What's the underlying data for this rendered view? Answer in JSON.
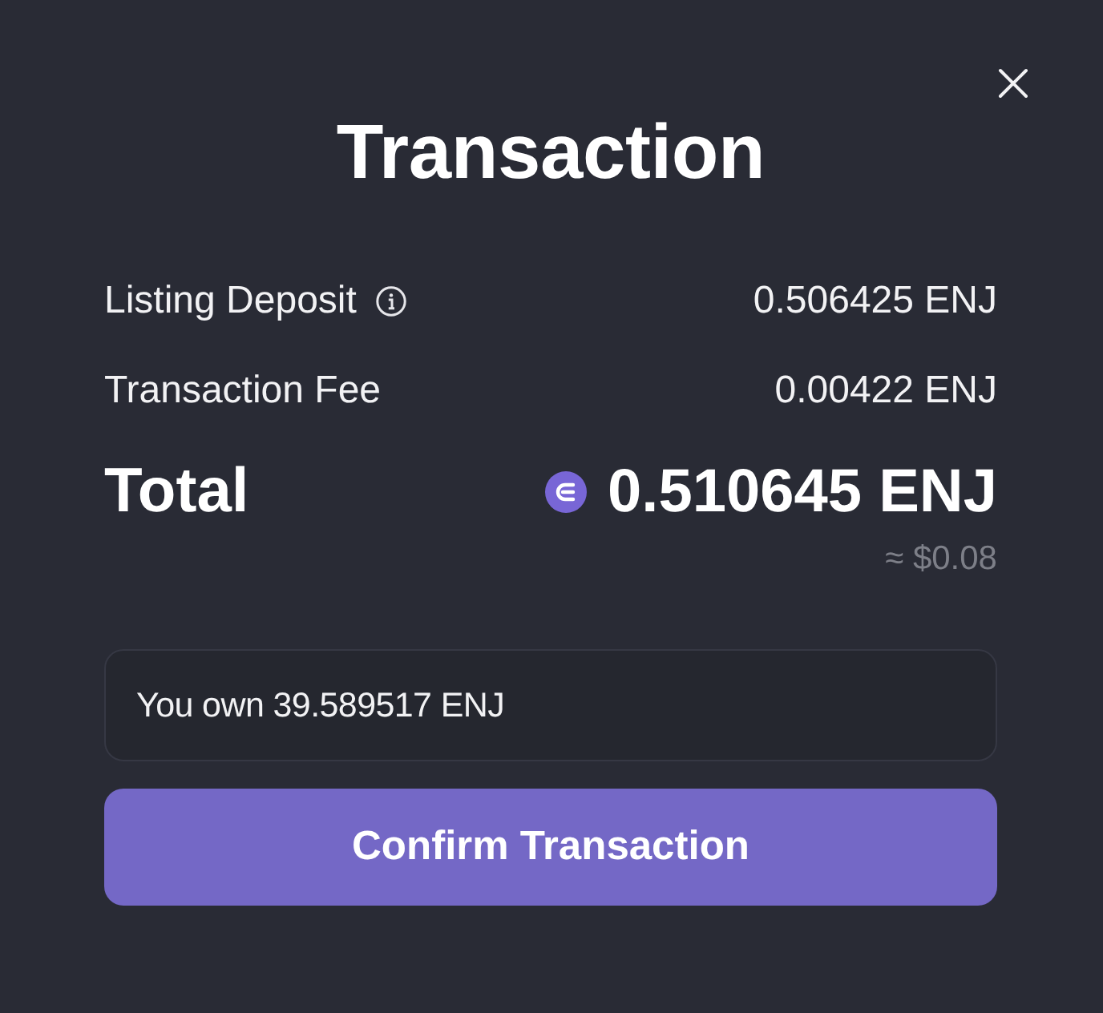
{
  "title": "Transaction",
  "lines": [
    {
      "label": "Listing Deposit",
      "info": true,
      "amount": "0.506425 ENJ"
    },
    {
      "label": "Transaction Fee",
      "info": false,
      "amount": "0.00422 ENJ"
    }
  ],
  "total": {
    "label": "Total",
    "amount": "0.510645 ENJ",
    "fiat": "≈ $0.08"
  },
  "balance": "You own 39.589517 ENJ",
  "confirm_button": "Confirm Transaction"
}
